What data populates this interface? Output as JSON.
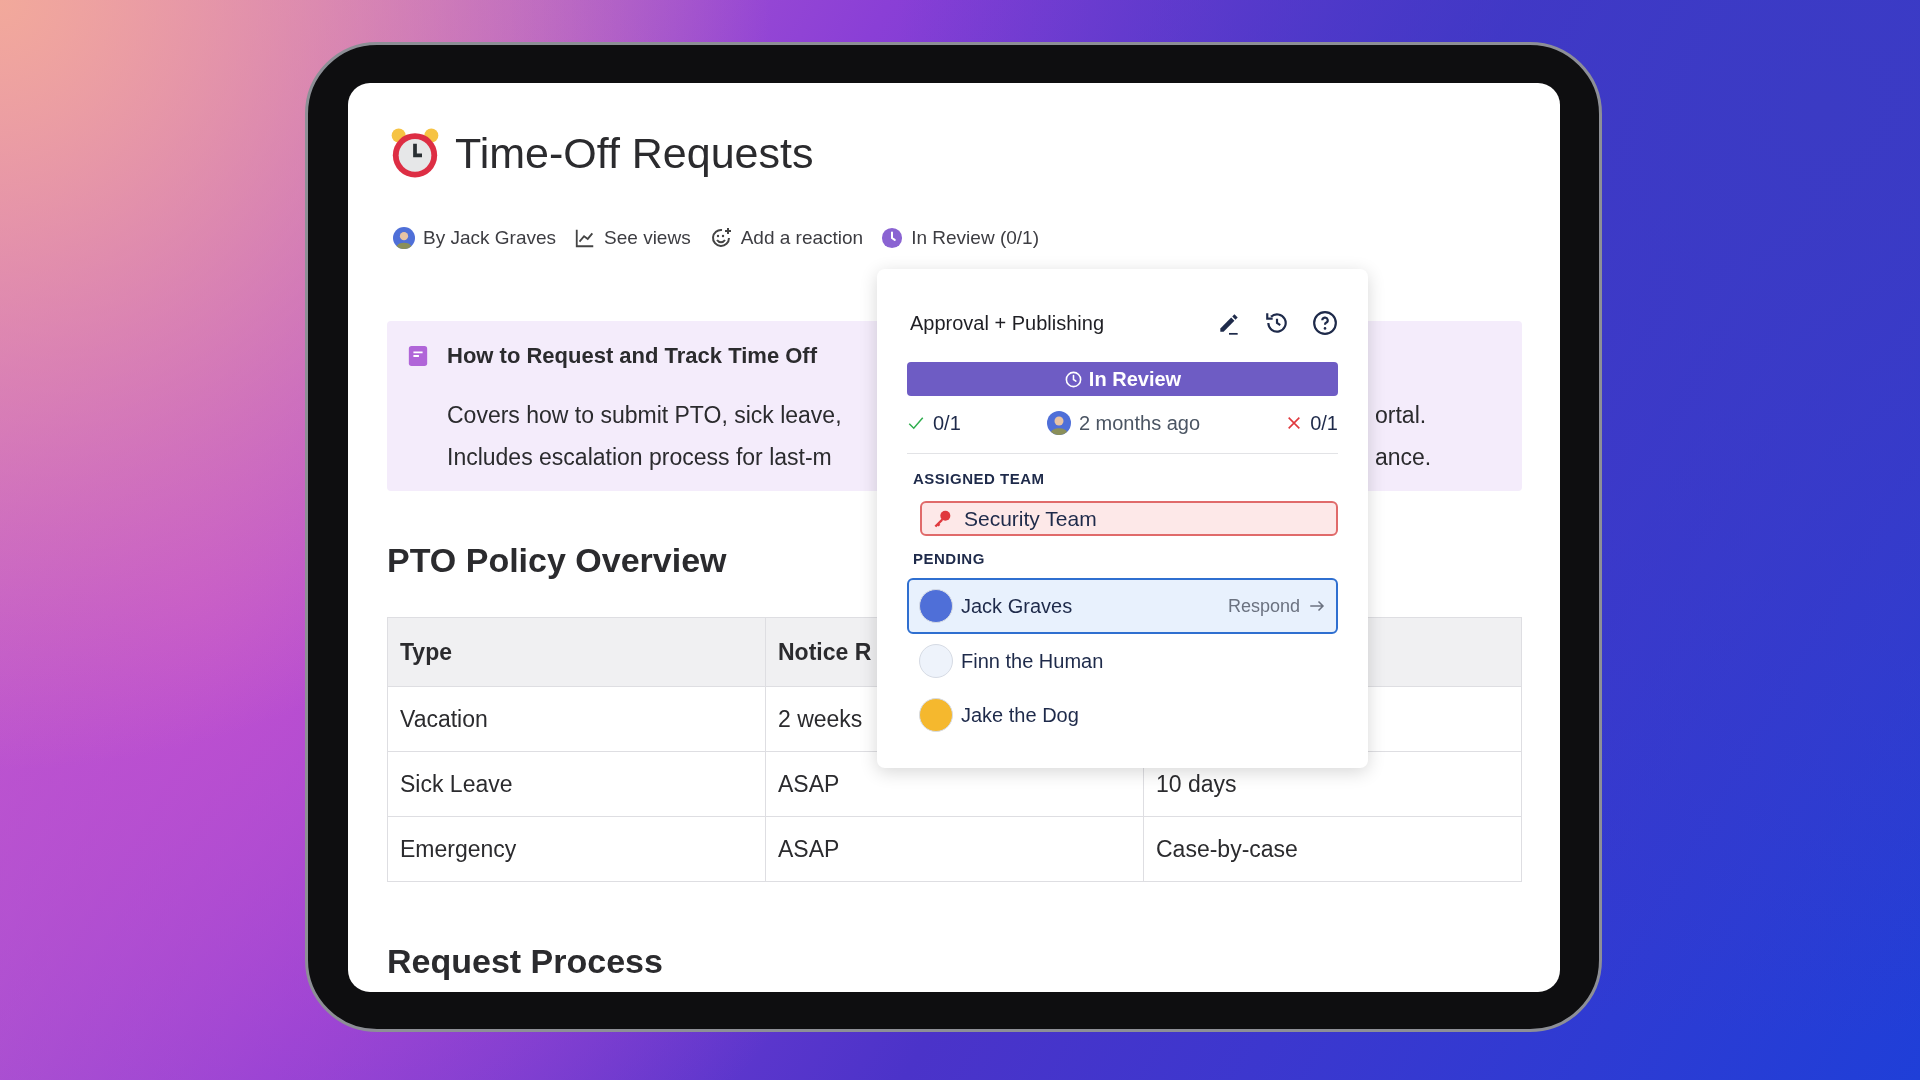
{
  "document": {
    "title": "Time-Off Requests",
    "meta": [
      {
        "kind": "author",
        "label": "By Jack Graves"
      },
      {
        "kind": "views",
        "label": "See views"
      },
      {
        "kind": "reaction",
        "label": "Add a reaction"
      },
      {
        "kind": "status",
        "label": "In Review (0/1)"
      }
    ],
    "callout": {
      "title": "How to Request and Track Time Off",
      "lines": [
        {
          "left": "Covers how to submit PTO, sick leave,",
          "right": "ortal."
        },
        {
          "left": "Includes escalation process for last-m",
          "right": "ance."
        }
      ]
    },
    "section_heading": "PTO Policy Overview",
    "table": {
      "columns": [
        "Type",
        "Notice R"
      ],
      "rows": [
        [
          "Vacation",
          "2 weeks"
        ],
        [
          "Sick Leave",
          "ASAP",
          "10 days"
        ],
        [
          "Emergency",
          "ASAP",
          "Case-by-case"
        ]
      ]
    },
    "next_heading": "Request Process"
  },
  "approval_popover": {
    "title": "Approval + Publishing",
    "status": "In Review",
    "approved": "0/1",
    "updated": "2 months ago",
    "rejected": "0/1",
    "assigned_team_label": "ASSIGNED TEAM",
    "team": "Security Team",
    "pending_label": "PENDING",
    "reviewers": [
      {
        "name": "Jack Graves",
        "selected": true,
        "action": "Respond"
      },
      {
        "name": "Finn the Human",
        "selected": false
      },
      {
        "name": "Jake the Dog",
        "selected": false
      }
    ]
  }
}
